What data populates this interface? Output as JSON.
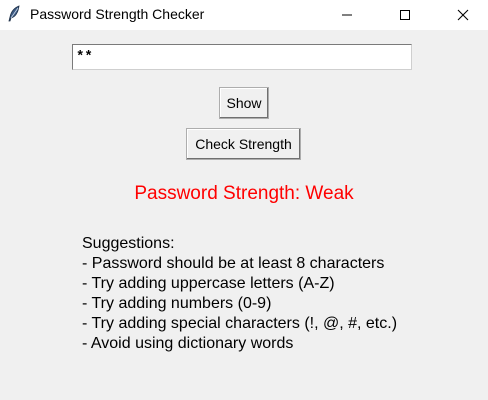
{
  "window": {
    "title": "Password Strength Checker",
    "controls": {
      "minimize": "minimize-icon",
      "maximize": "maximize-icon",
      "close": "close-icon"
    }
  },
  "form": {
    "password_value": "**",
    "show_label": "Show",
    "check_label": "Check Strength"
  },
  "result": {
    "strength_text": "Password Strength: Weak",
    "strength_color": "#ff0000"
  },
  "suggestions": {
    "heading": "Suggestions:",
    "items": [
      "- Password should be at least 8 characters",
      "- Try adding uppercase letters (A-Z)",
      "- Try adding numbers (0-9)",
      "- Try adding special characters (!, @, #, etc.)",
      "- Avoid using dictionary words"
    ]
  }
}
